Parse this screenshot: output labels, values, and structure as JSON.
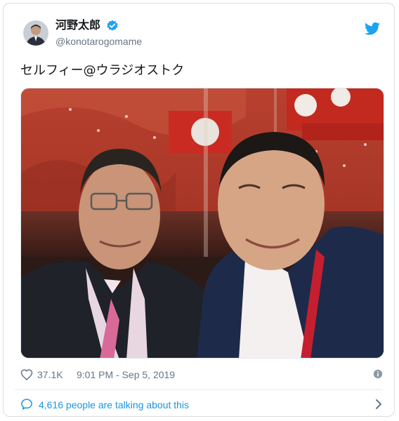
{
  "tweet": {
    "author": {
      "display_name": "河野太郎",
      "handle": "@konotarogomame",
      "verified": true
    },
    "text": "セルフィー@ウラジオストク",
    "photo": {
      "description_icon": "photo-selfie"
    },
    "likes": "37.1K",
    "timestamp": "9:01 PM - Sep 5, 2019",
    "conversation": "4,616 people are talking about this"
  },
  "colors": {
    "twitter_blue": "#1da1f2",
    "link_blue": "#1b95e0",
    "secondary_text": "#657786",
    "border": "#d8dde2"
  },
  "icons": {
    "verified": "verified-badge-icon",
    "twitter": "twitter-bird-icon",
    "like": "heart-icon",
    "info": "info-icon",
    "talk": "speech-bubble-icon",
    "chevron": "chevron-right-icon"
  }
}
